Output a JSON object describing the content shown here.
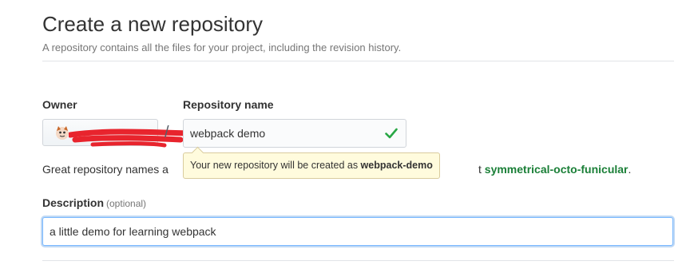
{
  "header": {
    "title": "Create a new repository",
    "subtitle": "A repository contains all the files for your project, including the revision history."
  },
  "form": {
    "owner_label": "Owner",
    "owner_name": "",
    "owner_avatar_icon": "octocat-avatar-icon",
    "separator": "/",
    "repo_label": "Repository name",
    "repo_value": "webpack demo",
    "repo_valid_icon": "check-icon",
    "hint_prefix": "Great repository names a",
    "hint_suffix": "t ",
    "hint_suggestion": "symmetrical-octo-funicular",
    "hint_end": ".",
    "tooltip_prefix": "Your new repository will be created as ",
    "tooltip_repo": "webpack-demo",
    "description_label": "Description",
    "description_optional": "(optional)",
    "description_value": "a little demo for learning webpack"
  },
  "colors": {
    "valid_check": "#28a745",
    "suggestion": "#1a7f37",
    "tooltip_bg": "#fffbdd",
    "focus_border": "#79b8ff",
    "redaction": "#e8242d"
  }
}
